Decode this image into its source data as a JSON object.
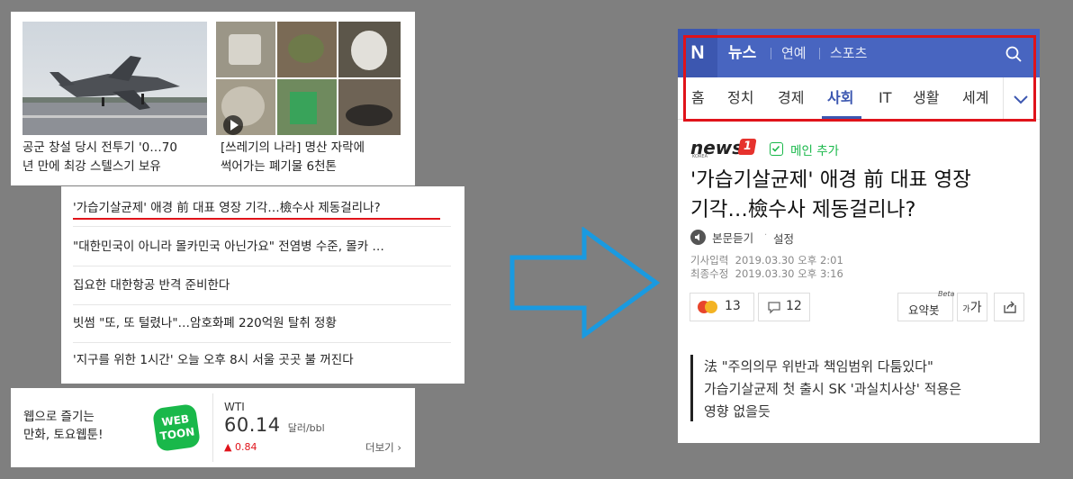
{
  "left": {
    "cards": [
      {
        "caption_line1": "공군 창설 당시 전투기 '0…70",
        "caption_line2": "년 만에 최강 스텔스기 보유"
      },
      {
        "caption_line1": "[쓰레기의 나라] 명산 자락에",
        "caption_line2": "썩어가는 폐기물 6천톤"
      }
    ],
    "headlines": [
      "'가습기살균제' 애경 前 대표 영장 기각…檢수사 제동걸리나?",
      "\"대한민국이 아니라 몰카민국 아닌가요\" 전염병 수준, 몰카 …",
      "집요한 대한항공 반격 준비한다",
      "빗썸 \"또, 또 털렸나\"…암호화폐 220억원 탈취 정황",
      "'지구를 위한 1시간' 오늘 오후 8시 서울 곳곳 불 꺼진다"
    ],
    "webtoon": {
      "line1": "웹으로 즐기는",
      "line2": "만화, 토요웹툰!",
      "logo_top": "WEB",
      "logo_bottom": "TOON"
    },
    "wti": {
      "label": "WTI",
      "value": "60.14",
      "unit": "달러/bbl",
      "change": "▲ 0.84",
      "more": "더보기 ›"
    }
  },
  "mobile": {
    "logo": "N",
    "nav": {
      "news": "뉴스",
      "ent": "연예",
      "sports": "스포츠"
    },
    "categories": [
      "홈",
      "정치",
      "경제",
      "사회",
      "IT",
      "생활",
      "세계"
    ],
    "active_category": "사회",
    "press_logo": "news",
    "press_logo_num": "1",
    "press_logo_sub": "KOREA",
    "main_add": "메인 추가",
    "title_line1": "'가습기살균제' 애경 前 대표 영장",
    "title_line2": "기각…檢수사 제동걸리나?",
    "listen": "본문듣기",
    "settings": "설정",
    "date_input_label": "기사입력",
    "date_input": "2019.03.30 오후 2:01",
    "date_edit_label": "최종수정",
    "date_edit": "2019.03.30 오후 3:16",
    "reaction_count": "13",
    "comment_count": "12",
    "summary": "요약봇",
    "summary_beta": "Beta",
    "font_btn": "가",
    "font_btn_small": "가",
    "quote_line1": "法 \"주의의무 위반과 책임범위 다툼있다\"",
    "quote_line2": "가습기살균제 첫 출시 SK '과실치사상' 적용은",
    "quote_line3": "영향 없을듯"
  },
  "colors": {
    "accent_blue": "#4865c0",
    "highlight_red": "#e0131a",
    "arrow_blue": "#1a9ae0",
    "naver_green": "#19b84a"
  }
}
